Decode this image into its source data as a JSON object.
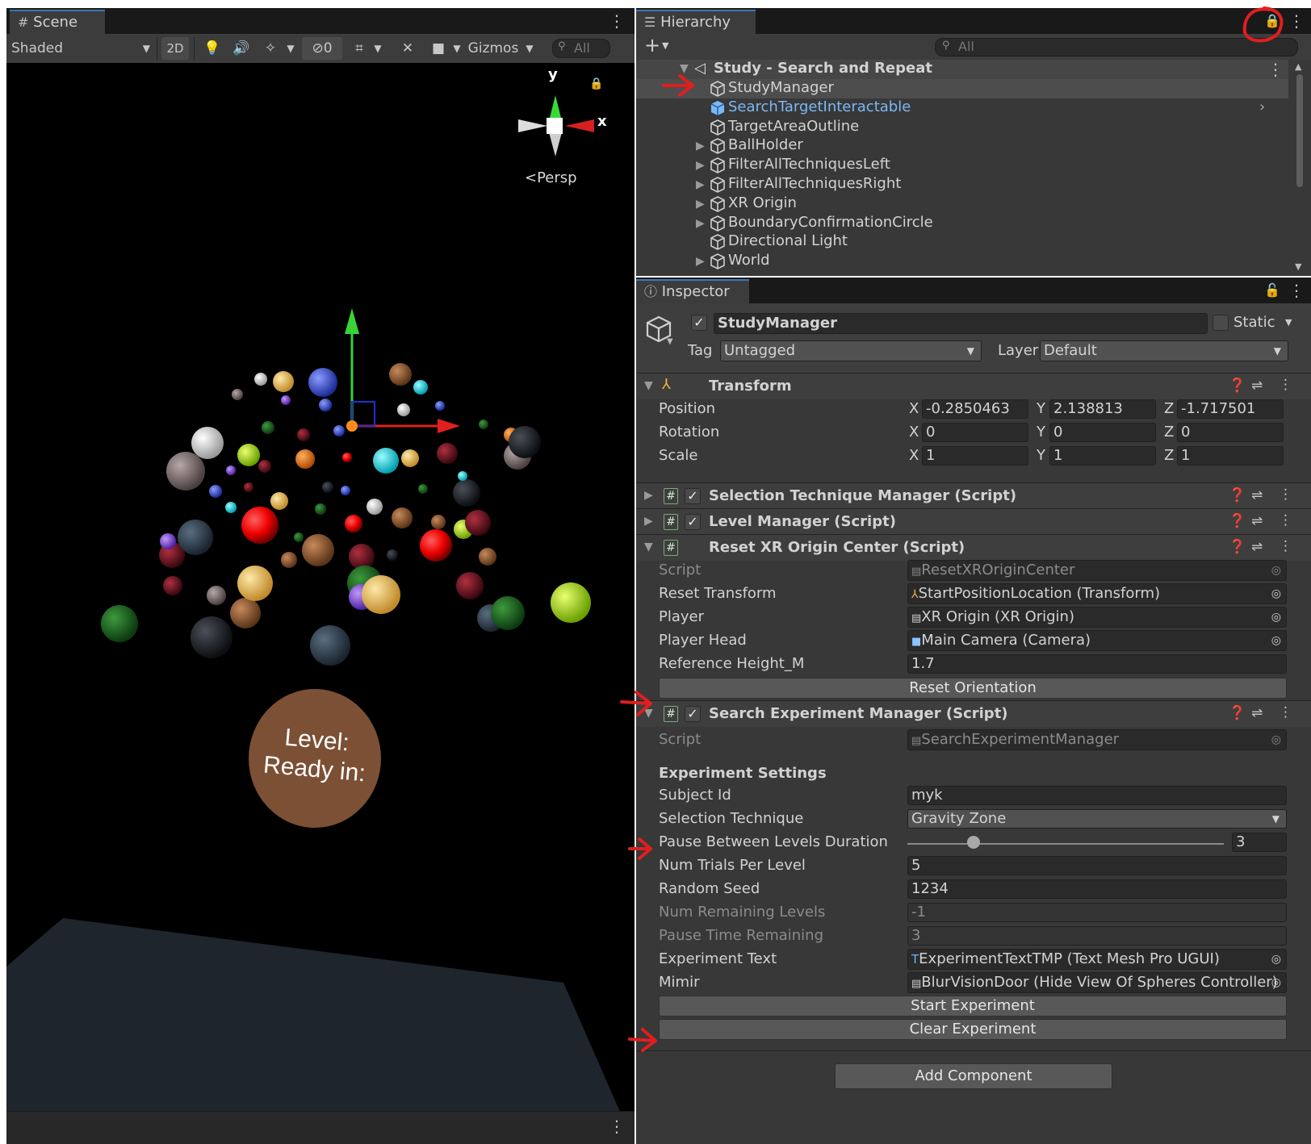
{
  "scene": {
    "tab_label": "Scene",
    "shading_mode": "Shaded",
    "mode_2d": "2D",
    "hidden_count": "0",
    "gizmos_label": "Gizmos",
    "search_placeholder": "All",
    "axis_y": "y",
    "axis_x": "x",
    "projection": "Persp",
    "world_text_line1": "Level:",
    "world_text_line2": "Ready in:"
  },
  "hierarchy": {
    "tab_label": "Hierarchy",
    "search_placeholder": "All",
    "scene_name": "Study - Search and Repeat",
    "items": [
      {
        "label": "StudyManager",
        "expandable": false,
        "selected": true,
        "prefab": false
      },
      {
        "label": "SearchTargetInteractable",
        "expandable": false,
        "selected": false,
        "prefab": true
      },
      {
        "label": "TargetAreaOutline",
        "expandable": false,
        "selected": false,
        "prefab": false
      },
      {
        "label": "BallHolder",
        "expandable": true,
        "selected": false,
        "prefab": false
      },
      {
        "label": "FilterAllTechniquesLeft",
        "expandable": true,
        "selected": false,
        "prefab": false
      },
      {
        "label": "FilterAllTechniquesRight",
        "expandable": true,
        "selected": false,
        "prefab": false
      },
      {
        "label": "XR Origin",
        "expandable": true,
        "selected": false,
        "prefab": false
      },
      {
        "label": "BoundaryConfirmationCircle",
        "expandable": true,
        "selected": false,
        "prefab": false
      },
      {
        "label": "Directional Light",
        "expandable": false,
        "selected": false,
        "prefab": false
      },
      {
        "label": "World",
        "expandable": true,
        "selected": false,
        "prefab": false
      }
    ]
  },
  "inspector": {
    "tab_label": "Inspector",
    "object_name": "StudyManager",
    "static_label": "Static",
    "tag_label": "Tag",
    "tag_value": "Untagged",
    "layer_label": "Layer",
    "layer_value": "Default",
    "transform": {
      "title": "Transform",
      "position_label": "Position",
      "rotation_label": "Rotation",
      "scale_label": "Scale",
      "axis_x": "X",
      "axis_y": "Y",
      "axis_z": "Z",
      "position": {
        "x": "-0.2850463",
        "y": "2.138813",
        "z": "-1.717501"
      },
      "rotation": {
        "x": "0",
        "y": "0",
        "z": "0"
      },
      "scale": {
        "x": "1",
        "y": "1",
        "z": "1"
      }
    },
    "selection_technique_manager": {
      "title": "Selection Technique Manager (Script)"
    },
    "level_manager": {
      "title": "Level Manager (Script)"
    },
    "reset_xr": {
      "title": "Reset XR Origin Center (Script)",
      "script_label": "Script",
      "script_value": "ResetXROriginCenter",
      "reset_transform_label": "Reset Transform",
      "reset_transform_value": "StartPositionLocation (Transform)",
      "player_label": "Player",
      "player_value": "XR Origin (XR Origin)",
      "player_head_label": "Player Head",
      "player_head_value": "Main Camera (Camera)",
      "ref_height_label": "Reference Height_M",
      "ref_height_value": "1.7",
      "reset_button": "Reset Orientation"
    },
    "search_exp": {
      "title": "Search Experiment Manager (Script)",
      "script_label": "Script",
      "script_value": "SearchExperimentManager",
      "section_header": "Experiment Settings",
      "subject_id_label": "Subject Id",
      "subject_id_value": "myk",
      "selection_technique_label": "Selection Technique",
      "selection_technique_value": "Gravity Zone",
      "pause_duration_label": "Pause Between Levels Duration",
      "pause_duration_value": "3",
      "pause_duration_slider_fraction": 0.21,
      "num_trials_label": "Num Trials Per Level",
      "num_trials_value": "5",
      "random_seed_label": "Random Seed",
      "random_seed_value": "1234",
      "num_remaining_label": "Num Remaining Levels",
      "num_remaining_value": "-1",
      "pause_remaining_label": "Pause Time Remaining",
      "pause_remaining_value": "3",
      "experiment_text_label": "Experiment Text",
      "experiment_text_value": "ExperimentTextTMP (Text Mesh Pro UGUI)",
      "mimir_label": "Mimir",
      "mimir_value": "BlurVisionDoor (Hide View Of Spheres Controller)",
      "start_button": "Start Experiment",
      "clear_button": "Clear Experiment"
    },
    "add_component_button": "Add Component"
  },
  "colors": {
    "selection_blue": "#3a79bb",
    "prefab_blue": "#7cb8f6",
    "annotation_red": "#e01e1e",
    "panel_dark": "#282828",
    "panel_mid": "#383838"
  }
}
